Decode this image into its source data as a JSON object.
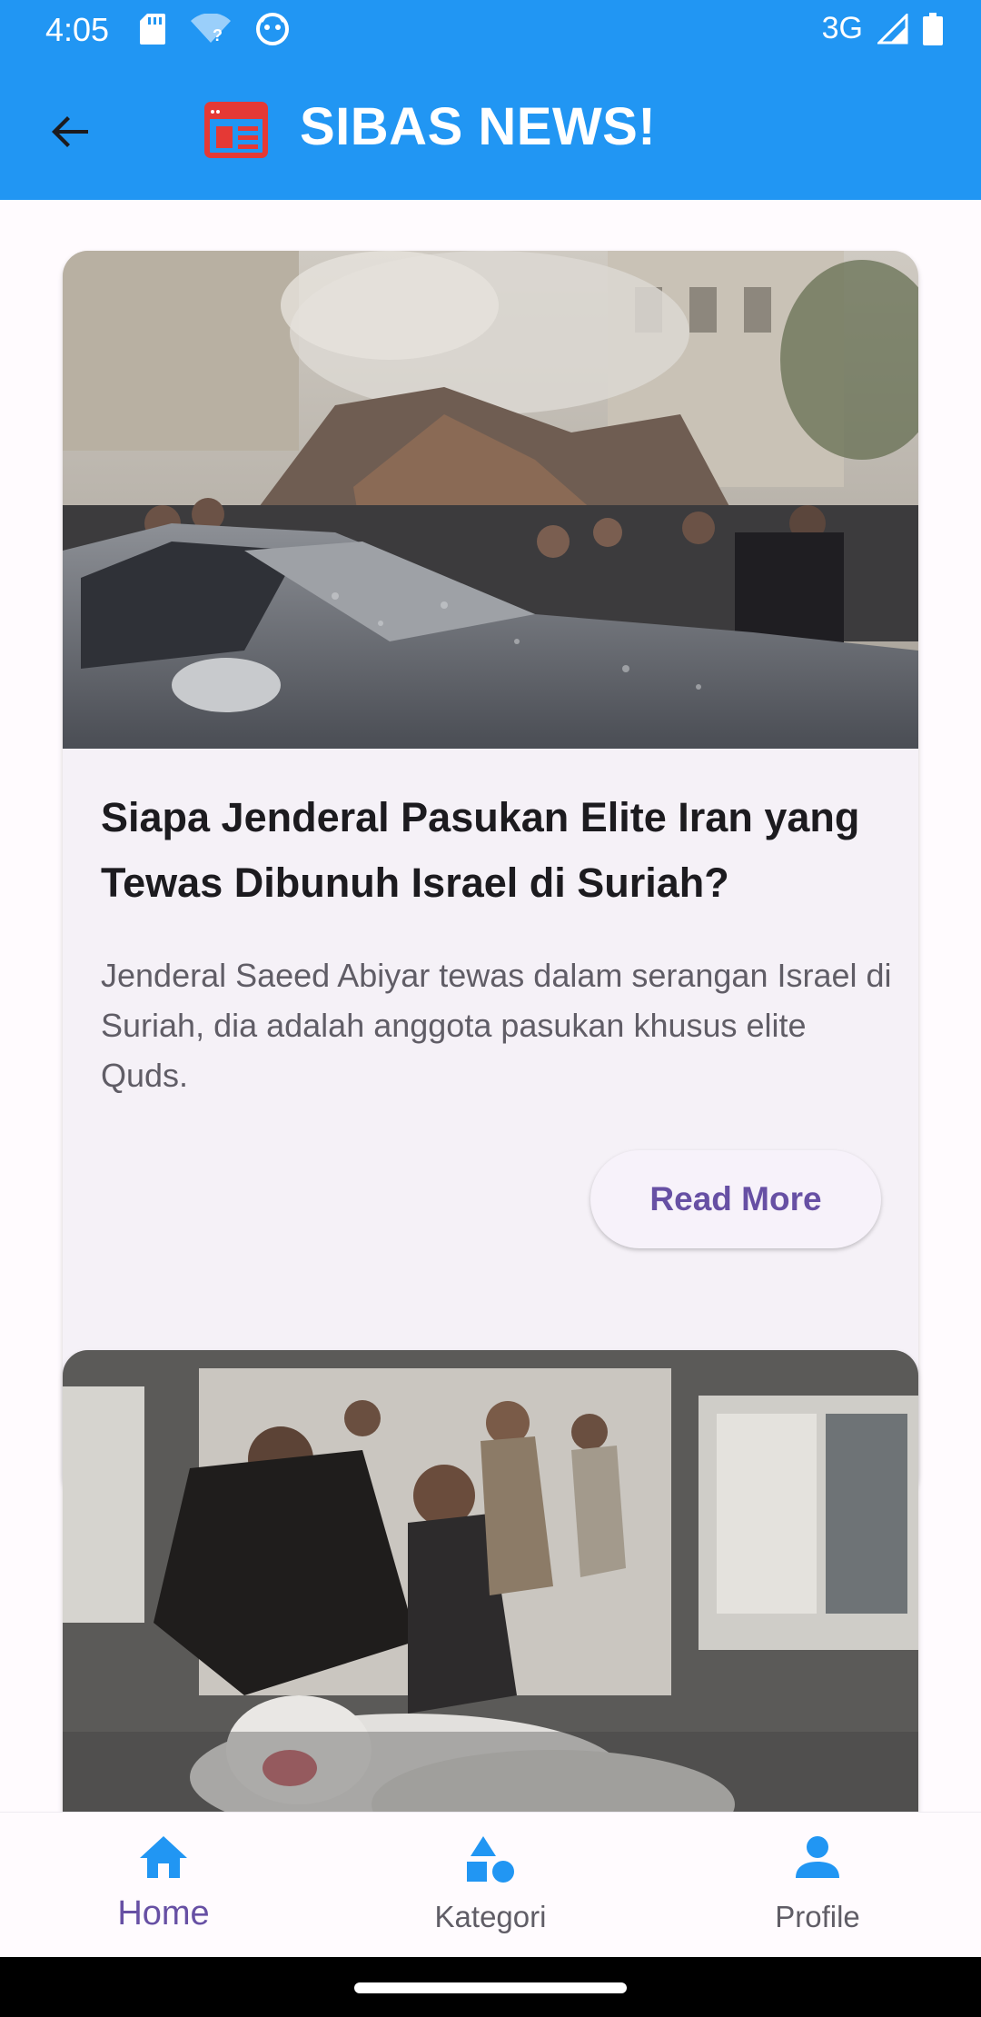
{
  "status_bar": {
    "time": "4:05",
    "network": "3G",
    "icons_left": [
      "sd-card-icon",
      "wifi-unknown-icon",
      "notification-face-icon"
    ],
    "icons_right": [
      "signal-icon",
      "battery-icon"
    ]
  },
  "app_bar": {
    "title": "SIBAS NEWS!",
    "background_color": "#2196f3",
    "logo_color": "#e53935"
  },
  "articles": [
    {
      "title": "Siapa Jenderal Pasukan Elite Iran yang Tewas Dibunuh Israel di Suriah?",
      "description": "Jenderal Saeed Abiyar tewas dalam serangan Israel di Suriah, dia adalah anggota pasukan khusus elite Quds.",
      "button_label": "Read More"
    },
    {
      "title": "",
      "description": "",
      "button_label": ""
    }
  ],
  "bottom_nav": {
    "items": [
      {
        "label": "Home",
        "icon": "home-icon",
        "active": true
      },
      {
        "label": "Kategori",
        "icon": "category-shapes-icon",
        "active": false
      },
      {
        "label": "Profile",
        "icon": "person-icon",
        "active": false
      }
    ],
    "active_color": "#6750a4",
    "icon_color": "#2196f3"
  }
}
